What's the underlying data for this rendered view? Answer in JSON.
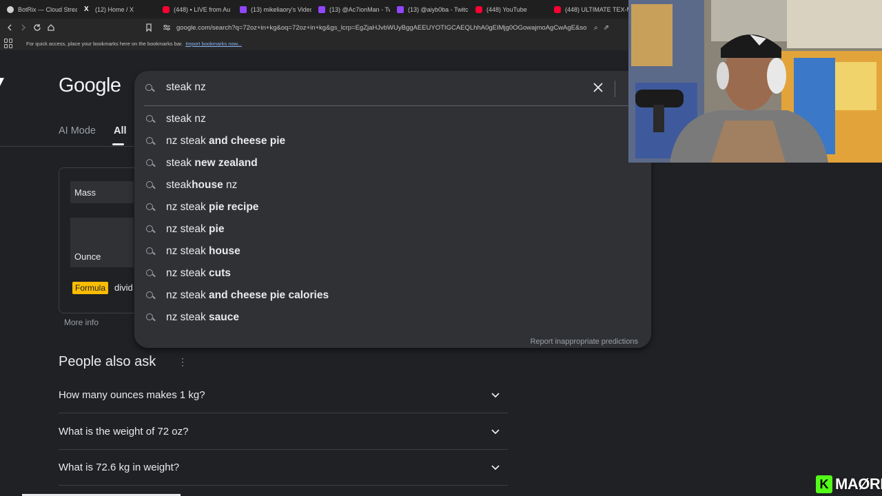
{
  "browser": {
    "tabs": [
      {
        "label": "BotRix — Cloud Strea",
        "icon": "bot-icon"
      },
      {
        "label": "(12) Home / X",
        "icon": "x-icon"
      },
      {
        "label": "(448) ▪ LIVE from Au",
        "icon": "youtube-icon"
      },
      {
        "label": "(13) mikeliaory's Video",
        "icon": "twitch-icon"
      },
      {
        "label": "(13) @Ac7ionMan - Tw",
        "icon": "twitch-icon"
      },
      {
        "label": "(13) @aiyb0ba - Twitch",
        "icon": "twitch-icon"
      },
      {
        "label": "(448) YouTube",
        "icon": "youtube-icon"
      },
      {
        "label": "(448) ULTIMATE TEX-M",
        "icon": "youtube-icon"
      }
    ],
    "url": "google.com/search?q=72oz+in+kg&oq=72oz+in+kg&gs_lcrp=EgZjaHJvbWUyBggAEEUYOTIGCAEQLhhA0gEIMjg0OGowajmoAgCwAgE&sourc...",
    "bookmarks_hint": "For quick access, place your bookmarks here on the bookmarks bar.",
    "bookmarks_link": "Import bookmarks now..."
  },
  "google": {
    "logo": "Google",
    "modes": [
      "AI Mode",
      "All"
    ],
    "converter": {
      "quantity": "Mass",
      "from_value": "",
      "unit": "Ounce",
      "formula_tag": "Formula",
      "formula_text": "divid",
      "more_info": "More info"
    },
    "people_also_ask": {
      "title": "People also ask",
      "questions": [
        "How many ounces makes 1 kg?",
        "What is the weight of 72 oz?",
        "What is 72.6 kg in weight?"
      ]
    }
  },
  "search": {
    "query": "steak nz",
    "suggestions": [
      {
        "plain": "steak nz",
        "bold": ""
      },
      {
        "plain": "nz steak",
        "bold": " and cheese pie"
      },
      {
        "plain": "steak",
        "bold": " new zealand"
      },
      {
        "plain": "steak",
        "bold": "house",
        "tail": " nz"
      },
      {
        "plain": "nz steak",
        "bold": " pie recipe"
      },
      {
        "plain": "nz steak",
        "bold": " pie"
      },
      {
        "plain": "nz steak",
        "bold": " house"
      },
      {
        "plain": "nz steak",
        "bold": " cuts"
      },
      {
        "plain": "nz steak",
        "bold": " and cheese pie calories"
      },
      {
        "plain": "nz steak",
        "bold": " sauce"
      }
    ],
    "report": "Report inappropriate predictions"
  },
  "overlay": {
    "badge_letter": "K",
    "badge_text": "MAØRI"
  },
  "colors": {
    "page_bg": "#202124",
    "dropdown_bg": "#303134",
    "formula_bg": "#fbbc04",
    "kick_green": "#53fc18"
  }
}
